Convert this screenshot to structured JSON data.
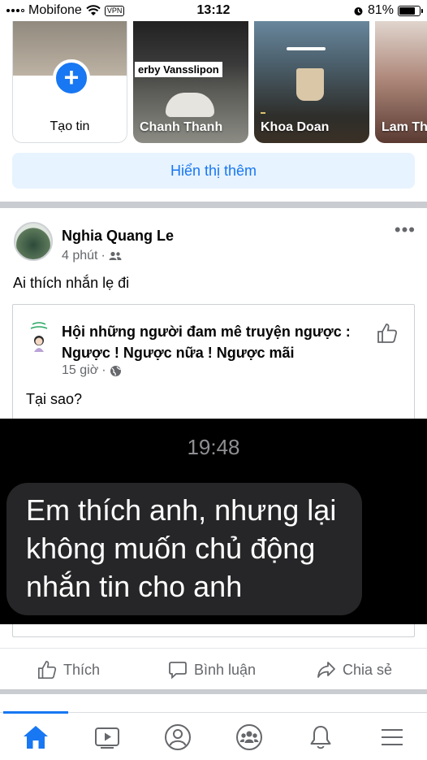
{
  "status_bar": {
    "carrier": "Mobifone",
    "vpn": "VPN",
    "time": "13:12",
    "battery": "81%",
    "battery_level": 0.81
  },
  "stories": {
    "create_label": "Tạo tin",
    "items": [
      {
        "name": "Chanh Thanh",
        "overlay_text": "erby Vansslipon"
      },
      {
        "name": "Khoa Doan"
      },
      {
        "name": "Lam Th"
      }
    ]
  },
  "see_more_label": "Hiển thị thêm",
  "post": {
    "author": "Nghia Quang Le",
    "time": "4 phút",
    "text": "Ai thích nhắn lẹ đi",
    "shared": {
      "group_name": "Hội những người đam mê truyện ngược : Ngược ! Ngược nữa ! Ngược mãi",
      "time": "15 giờ",
      "text": "Tại sao?"
    }
  },
  "overlay": {
    "time": "19:48",
    "message": "Em thích anh, nhưng lại không muốn chủ động nhắn tin cho anh"
  },
  "actions": {
    "like": "Thích",
    "comment": "Bình luận",
    "share": "Chia sẻ"
  },
  "nav": {
    "items": [
      "home-icon",
      "video-icon",
      "profile-icon",
      "groups-icon",
      "notifications-icon",
      "menu-icon"
    ],
    "active": "home-icon"
  },
  "colors": {
    "accent": "#1877f2",
    "see_more_bg": "#e7f3ff",
    "secondary_text": "#65676b",
    "overlay_bubble": "#262628"
  }
}
